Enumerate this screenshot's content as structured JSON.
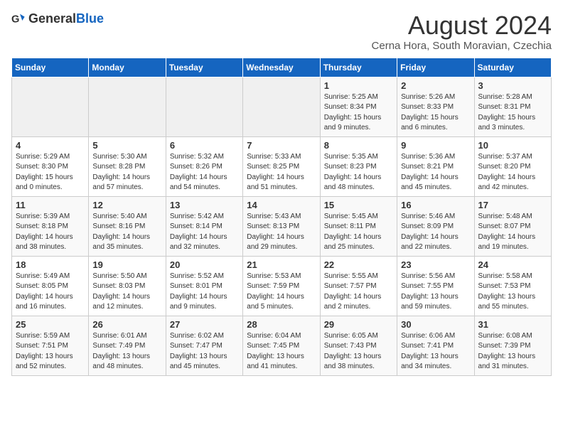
{
  "header": {
    "logo_general": "General",
    "logo_blue": "Blue",
    "month_year": "August 2024",
    "location": "Cerna Hora, South Moravian, Czechia"
  },
  "weekdays": [
    "Sunday",
    "Monday",
    "Tuesday",
    "Wednesday",
    "Thursday",
    "Friday",
    "Saturday"
  ],
  "weeks": [
    [
      {
        "day": "",
        "empty": true
      },
      {
        "day": "",
        "empty": true
      },
      {
        "day": "",
        "empty": true
      },
      {
        "day": "",
        "empty": true
      },
      {
        "day": "1",
        "sunrise": "5:25 AM",
        "sunset": "8:34 PM",
        "daylight": "15 hours and 9 minutes."
      },
      {
        "day": "2",
        "sunrise": "5:26 AM",
        "sunset": "8:33 PM",
        "daylight": "15 hours and 6 minutes."
      },
      {
        "day": "3",
        "sunrise": "5:28 AM",
        "sunset": "8:31 PM",
        "daylight": "15 hours and 3 minutes."
      }
    ],
    [
      {
        "day": "4",
        "sunrise": "5:29 AM",
        "sunset": "8:30 PM",
        "daylight": "15 hours and 0 minutes."
      },
      {
        "day": "5",
        "sunrise": "5:30 AM",
        "sunset": "8:28 PM",
        "daylight": "14 hours and 57 minutes."
      },
      {
        "day": "6",
        "sunrise": "5:32 AM",
        "sunset": "8:26 PM",
        "daylight": "14 hours and 54 minutes."
      },
      {
        "day": "7",
        "sunrise": "5:33 AM",
        "sunset": "8:25 PM",
        "daylight": "14 hours and 51 minutes."
      },
      {
        "day": "8",
        "sunrise": "5:35 AM",
        "sunset": "8:23 PM",
        "daylight": "14 hours and 48 minutes."
      },
      {
        "day": "9",
        "sunrise": "5:36 AM",
        "sunset": "8:21 PM",
        "daylight": "14 hours and 45 minutes."
      },
      {
        "day": "10",
        "sunrise": "5:37 AM",
        "sunset": "8:20 PM",
        "daylight": "14 hours and 42 minutes."
      }
    ],
    [
      {
        "day": "11",
        "sunrise": "5:39 AM",
        "sunset": "8:18 PM",
        "daylight": "14 hours and 38 minutes."
      },
      {
        "day": "12",
        "sunrise": "5:40 AM",
        "sunset": "8:16 PM",
        "daylight": "14 hours and 35 minutes."
      },
      {
        "day": "13",
        "sunrise": "5:42 AM",
        "sunset": "8:14 PM",
        "daylight": "14 hours and 32 minutes."
      },
      {
        "day": "14",
        "sunrise": "5:43 AM",
        "sunset": "8:13 PM",
        "daylight": "14 hours and 29 minutes."
      },
      {
        "day": "15",
        "sunrise": "5:45 AM",
        "sunset": "8:11 PM",
        "daylight": "14 hours and 25 minutes."
      },
      {
        "day": "16",
        "sunrise": "5:46 AM",
        "sunset": "8:09 PM",
        "daylight": "14 hours and 22 minutes."
      },
      {
        "day": "17",
        "sunrise": "5:48 AM",
        "sunset": "8:07 PM",
        "daylight": "14 hours and 19 minutes."
      }
    ],
    [
      {
        "day": "18",
        "sunrise": "5:49 AM",
        "sunset": "8:05 PM",
        "daylight": "14 hours and 16 minutes."
      },
      {
        "day": "19",
        "sunrise": "5:50 AM",
        "sunset": "8:03 PM",
        "daylight": "14 hours and 12 minutes."
      },
      {
        "day": "20",
        "sunrise": "5:52 AM",
        "sunset": "8:01 PM",
        "daylight": "14 hours and 9 minutes."
      },
      {
        "day": "21",
        "sunrise": "5:53 AM",
        "sunset": "7:59 PM",
        "daylight": "14 hours and 5 minutes."
      },
      {
        "day": "22",
        "sunrise": "5:55 AM",
        "sunset": "7:57 PM",
        "daylight": "14 hours and 2 minutes."
      },
      {
        "day": "23",
        "sunrise": "5:56 AM",
        "sunset": "7:55 PM",
        "daylight": "13 hours and 59 minutes."
      },
      {
        "day": "24",
        "sunrise": "5:58 AM",
        "sunset": "7:53 PM",
        "daylight": "13 hours and 55 minutes."
      }
    ],
    [
      {
        "day": "25",
        "sunrise": "5:59 AM",
        "sunset": "7:51 PM",
        "daylight": "13 hours and 52 minutes."
      },
      {
        "day": "26",
        "sunrise": "6:01 AM",
        "sunset": "7:49 PM",
        "daylight": "13 hours and 48 minutes."
      },
      {
        "day": "27",
        "sunrise": "6:02 AM",
        "sunset": "7:47 PM",
        "daylight": "13 hours and 45 minutes."
      },
      {
        "day": "28",
        "sunrise": "6:04 AM",
        "sunset": "7:45 PM",
        "daylight": "13 hours and 41 minutes."
      },
      {
        "day": "29",
        "sunrise": "6:05 AM",
        "sunset": "7:43 PM",
        "daylight": "13 hours and 38 minutes."
      },
      {
        "day": "30",
        "sunrise": "6:06 AM",
        "sunset": "7:41 PM",
        "daylight": "13 hours and 34 minutes."
      },
      {
        "day": "31",
        "sunrise": "6:08 AM",
        "sunset": "7:39 PM",
        "daylight": "13 hours and 31 minutes."
      }
    ]
  ]
}
